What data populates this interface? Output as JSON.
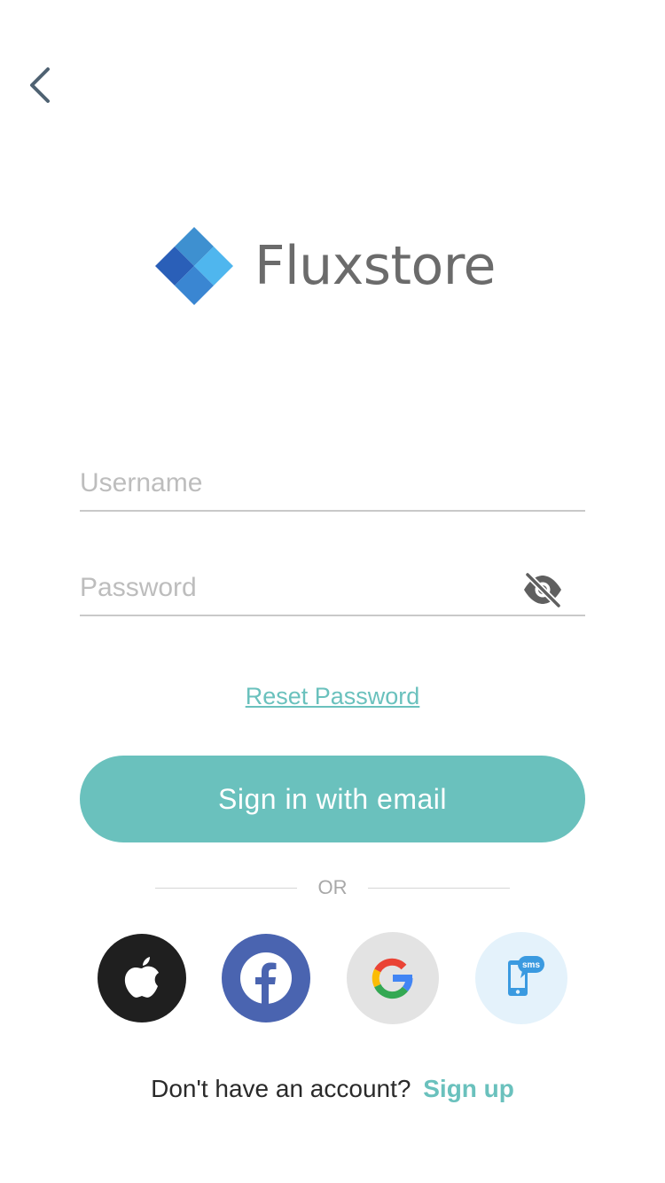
{
  "brand": {
    "name": "Fluxstore",
    "logo_icon": "diamond-logo-icon"
  },
  "nav": {
    "back_icon": "chevron-left-icon"
  },
  "form": {
    "username": {
      "placeholder": "Username",
      "value": ""
    },
    "password": {
      "placeholder": "Password",
      "value": "",
      "toggle_icon": "eye-off-icon"
    },
    "reset_label": "Reset Password",
    "signin_label": "Sign in with email"
  },
  "divider": {
    "label": "OR"
  },
  "social": [
    {
      "name": "apple",
      "icon": "apple-icon",
      "color": "#1f1f1f"
    },
    {
      "name": "facebook",
      "icon": "facebook-icon",
      "color": "#4a64b0"
    },
    {
      "name": "google",
      "icon": "google-icon",
      "color": "#e3e3e3"
    },
    {
      "name": "sms",
      "icon": "sms-phone-icon",
      "color": "#e4f2fb",
      "label": "sms"
    }
  ],
  "signup": {
    "prompt": "Don't have an account?",
    "link_label": "Sign up"
  },
  "colors": {
    "accent": "#6ac1bd",
    "back_icon": "#4f6272",
    "logo_text": "#6b6b6b"
  }
}
